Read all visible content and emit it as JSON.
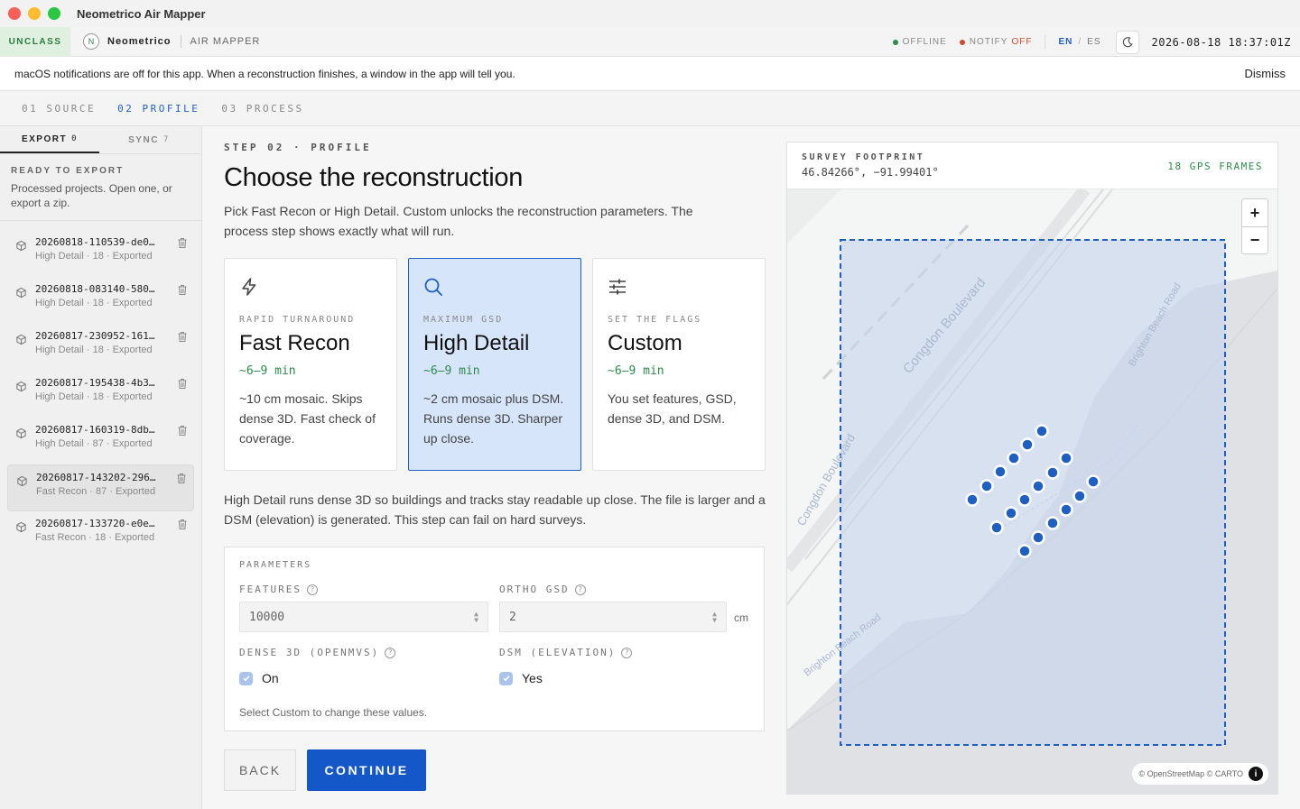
{
  "window": {
    "title": "Neometrico Air Mapper"
  },
  "topbar": {
    "classification": "UNCLASS",
    "brand_initial": "N",
    "brand_name": "Neometrico",
    "app_name": "AIR MAPPER",
    "status_offline": "OFFLINE",
    "notify_label": "NOTIFY",
    "notify_value": "OFF",
    "lang_en": "EN",
    "lang_sep": "/",
    "lang_es": "ES",
    "theme_icon": "moon-icon",
    "clock": "2026-08-18 18:37:01Z",
    "colors": {
      "offline_dot": "#2d8a4a",
      "notify_dot": "#d24a2a",
      "accent": "#1f5fc4"
    }
  },
  "banner": {
    "message": "macOS notifications are off for this app. When a reconstruction finishes, a window in the app will tell you.",
    "dismiss": "Dismiss"
  },
  "stepper": {
    "steps": [
      "01 SOURCE",
      "02 PROFILE",
      "03 PROCESS"
    ],
    "active_index": 1
  },
  "sidebar": {
    "tabs": [
      {
        "label": "EXPORT",
        "count": "0"
      },
      {
        "label": "SYNC",
        "count": "7"
      }
    ],
    "active_tab": 0,
    "heading": "READY TO EXPORT",
    "description": "Processed projects. Open one, or export a zip.",
    "projects": [
      {
        "name": "20260818-110539-de0…",
        "meta": "High Detail · 18 · Exported"
      },
      {
        "name": "20260818-083140-580…",
        "meta": "High Detail · 18 · Exported"
      },
      {
        "name": "20260817-230952-161…",
        "meta": "High Detail · 18 · Exported"
      },
      {
        "name": "20260817-195438-4b3…",
        "meta": "High Detail · 18 · Exported"
      },
      {
        "name": "20260817-160319-8db…",
        "meta": "High Detail · 87 · Exported"
      },
      {
        "name": "20260817-143202-296…",
        "meta": "Fast Recon · 87 · Exported"
      },
      {
        "name": "20260817-133720-e0e…",
        "meta": "Fast Recon · 18 · Exported"
      }
    ],
    "selected_project": 5
  },
  "main": {
    "eyebrow": "STEP 02 · PROFILE",
    "title": "Choose the reconstruction",
    "lead": "Pick Fast Recon or High Detail. Custom unlocks the reconstruction parameters. The process step shows exactly what will run.",
    "cards": [
      {
        "icon": "lightning-icon",
        "kicker": "RAPID TURNAROUND",
        "title": "Fast Recon",
        "time": "~6–9 min",
        "desc": "~10 cm mosaic. Skips dense 3D. Fast check of coverage."
      },
      {
        "icon": "search-icon",
        "kicker": "MAXIMUM GSD",
        "title": "High Detail",
        "time": "~6–9 min",
        "desc": "~2 cm mosaic plus DSM. Runs dense 3D. Sharper up close."
      },
      {
        "icon": "sliders-icon",
        "kicker": "SET THE FLAGS",
        "title": "Custom",
        "time": "~6–9 min",
        "desc": "You set features, GSD, dense 3D, and DSM."
      }
    ],
    "selected_card": 1,
    "explain": "High Detail runs dense 3D so buildings and tracks stay readable up close. The file is larger and a DSM (elevation) is generated. This step can fail on hard surveys.",
    "params": {
      "title": "PARAMETERS",
      "features_label": "FEATURES",
      "features_value": "10000",
      "ortho_label": "ORTHO GSD",
      "ortho_value": "2",
      "ortho_unit": "cm",
      "dense_label": "DENSE 3D (OPENMVS)",
      "dense_value": "On",
      "dense_checked": true,
      "dsm_label": "DSM (ELEVATION)",
      "dsm_value": "Yes",
      "dsm_checked": true,
      "note": "Select Custom to change these values."
    },
    "back": "BACK",
    "continue": "CONTINUE"
  },
  "map": {
    "heading": "SURVEY FOOTPRINT",
    "coords": "46.84266°, −91.99401°",
    "frames": "18 GPS FRAMES",
    "zoom_in": "+",
    "zoom_out": "−",
    "attribution": "© OpenStreetMap © CARTO",
    "info": "i",
    "road_labels": [
      "Congdon Boulevard",
      "Congdon Boulevard",
      "Brighton Beach Road",
      "Brighton Beach Road"
    ]
  }
}
